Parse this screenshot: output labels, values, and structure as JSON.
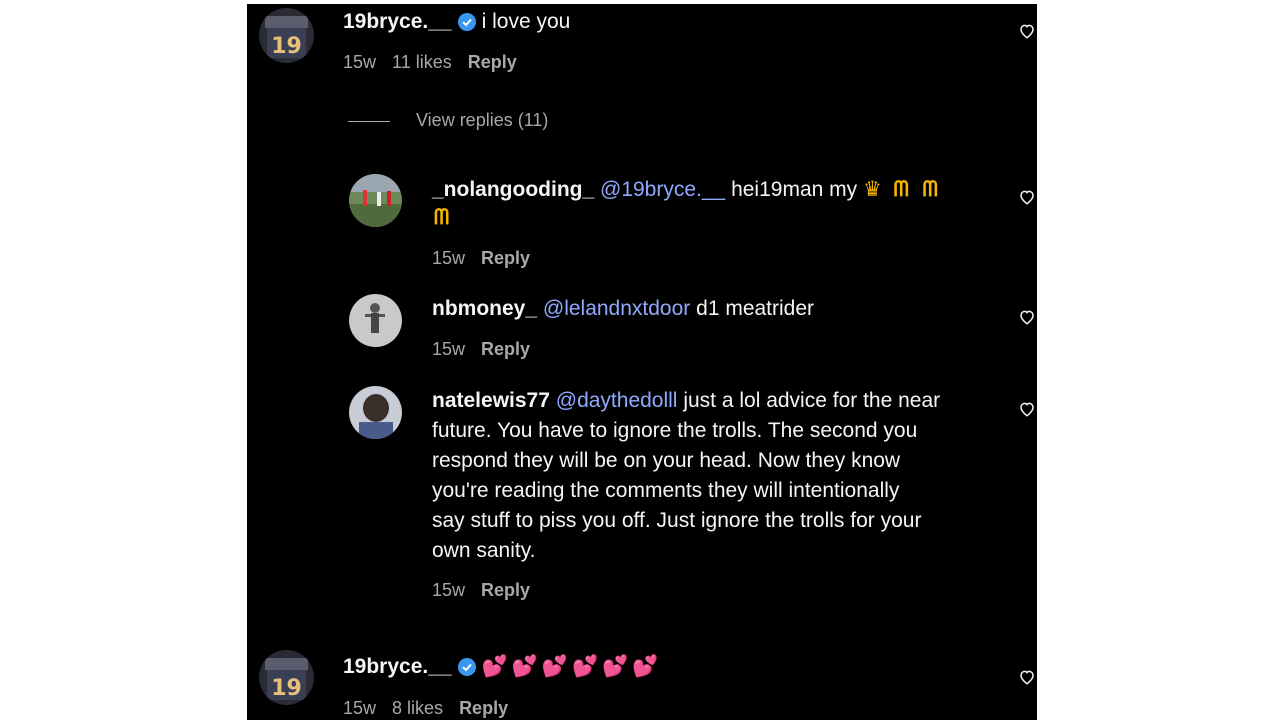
{
  "comments": [
    {
      "username": "19bryce.__",
      "verified": true,
      "text": "i love you",
      "time": "15w",
      "likes": "11 likes",
      "reply_label": "Reply"
    },
    {
      "username": "19bryce.__",
      "verified": true,
      "text": "💕💕💕💕💕💕",
      "time": "15w",
      "likes": "8 likes",
      "reply_label": "Reply"
    }
  ],
  "view_replies": "View replies (11)",
  "replies": [
    {
      "username": "_nolangooding_",
      "mention": "@19bryce.__",
      "text_line1": "hei19man my",
      "emoji_line1": "👑",
      "text_line2": "ᗰ",
      "time": "15w",
      "reply_label": "Reply"
    },
    {
      "username": "nbmoney_",
      "mention": "@lelandnxtdoor",
      "text": "d1 meatrider",
      "time": "15w",
      "reply_label": "Reply"
    },
    {
      "username": "natelewis77",
      "mention": "@daythedolll",
      "text_lines": [
        "just a lol advice for the near",
        "future. You have to ignore the trolls. The second you",
        "respond they will be on your head. Now they know",
        "you're reading the comments they will intentionally",
        "say stuff to piss you off. Just ignore the trolls for your",
        "own sanity."
      ],
      "time": "15w",
      "reply_label": "Reply"
    }
  ],
  "icons": {
    "like": "heart-outline-icon",
    "verified": "verified-badge-icon"
  },
  "colors": {
    "background": "#000000",
    "text": "#f5f5f5",
    "secondary": "#a8a8a8",
    "mention": "#8fa9ff",
    "verified": "#3897f0",
    "heart_emoji": "#ff4f8b",
    "crown": "#f5b400"
  }
}
